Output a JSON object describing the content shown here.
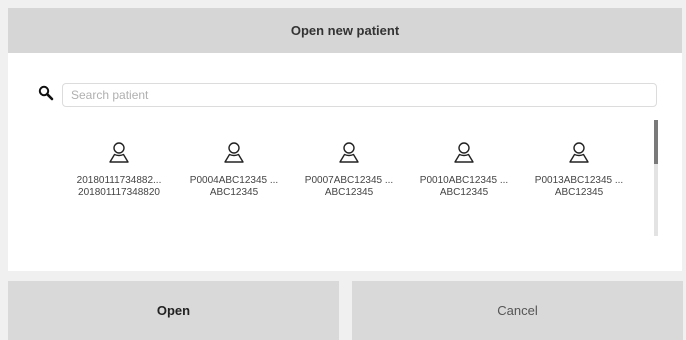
{
  "dialog": {
    "title": "Open new patient"
  },
  "search": {
    "placeholder": "Search patient",
    "value": "",
    "icon": "search-icon"
  },
  "patients": [
    {
      "line1": "20180111734882...",
      "line2": "201801117348820",
      "icon": "person-icon"
    },
    {
      "line1": "P0004ABC12345 ...",
      "line2": "ABC12345",
      "icon": "person-icon"
    },
    {
      "line1": "P0007ABC12345 ...",
      "line2": "ABC12345",
      "icon": "person-icon"
    },
    {
      "line1": "P0010ABC12345 ...",
      "line2": "ABC12345",
      "icon": "person-icon"
    },
    {
      "line1": "P0013ABC12345 ...",
      "line2": "ABC12345",
      "icon": "person-icon"
    }
  ],
  "footer": {
    "open_label": "Open",
    "cancel_label": "Cancel"
  },
  "colors": {
    "title_bar": "#d6d6d6",
    "content_bg": "#ffffff",
    "button_bg": "#d9d9d9",
    "scroll_thumb": "#7a7a7a"
  }
}
